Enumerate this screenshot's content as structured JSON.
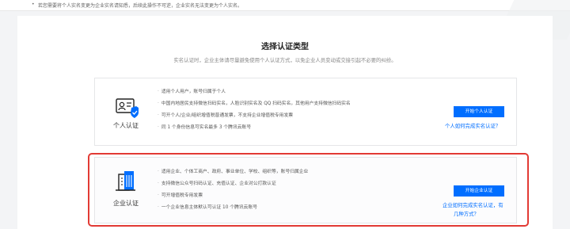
{
  "notice": {
    "text": "若您需要将个人实名变更为企业实名请知悉，后续此操作不可逆，企业实名无法变更为个人实名。"
  },
  "header": {
    "title": "选择认证类型",
    "subtitle": "实名认证时，企业主体请尽量避免使用个人认证方式，以免企业人员变动或交接引起不必要的纠纷。"
  },
  "personal": {
    "label": "个人认证",
    "icon": "id-card-shield-icon",
    "features": [
      "适用个人用户，账号归属于个人",
      "中国内地居民支持微信扫码实名，人脸识别实名及 QQ 扫码实名，其他用户支持微信扫码实名",
      "可开个人/企业/组织增值税普通发票，不支持企业增值税专用发票",
      "同 1 个身份信息可实名最多 3 个腾讯云账号"
    ],
    "button": "开始个人认证",
    "help": "个人如何完成实名认证？"
  },
  "enterprise": {
    "label": "企业认证",
    "icon": "building-icon",
    "features": [
      "适用企业、个体工商户、政府、事业单位、学校、组织等，账号归属企业",
      "支持微信公众号扫码认证、充值认证、企业对公打款认证",
      "可开增值税专用发票",
      "一个企业信息主体默认可认证 10 个腾讯云账号"
    ],
    "button": "开始企业认证",
    "help_line1": "企业如何完成实名认证，有",
    "help_line2": "几种方式？"
  },
  "colors": {
    "accent": "#006eff",
    "highlight": "#e23a34"
  }
}
